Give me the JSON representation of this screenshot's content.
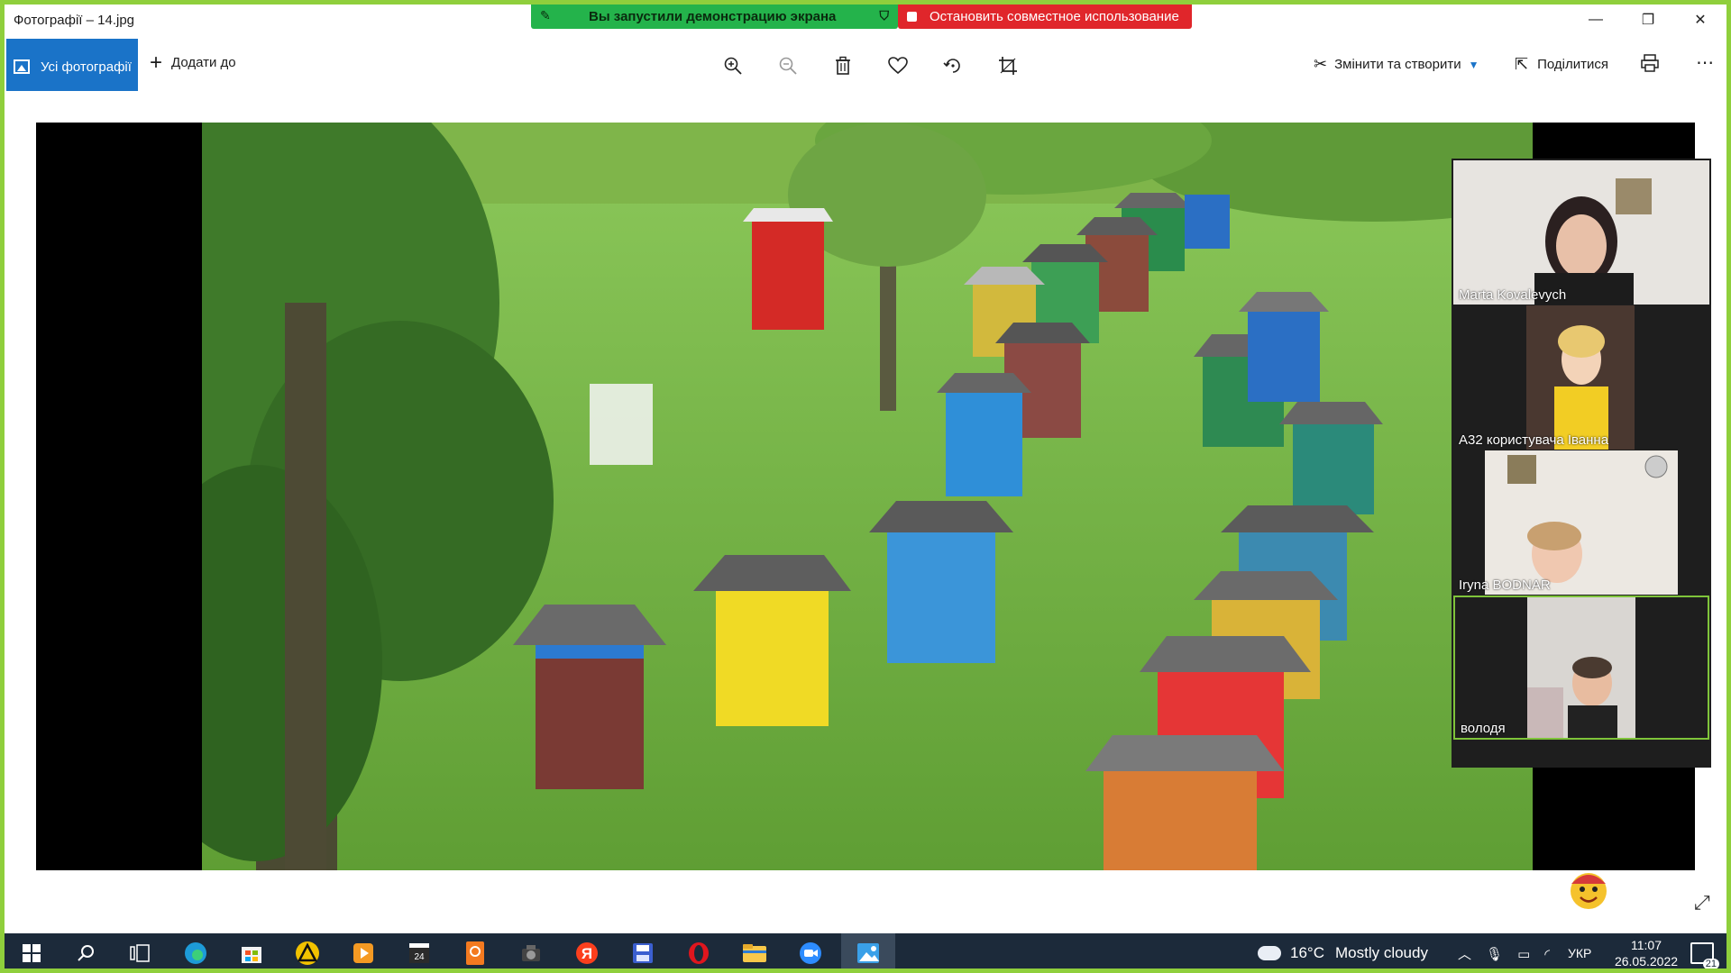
{
  "window": {
    "title": "Фотографії – 14.jpg",
    "minimize_glyph": "—",
    "restore_glyph": "❐",
    "close_glyph": "✕"
  },
  "screen_share": {
    "status_text": "Вы запустили демонстрацию экрана",
    "stop_text": "Остановить совместное использование",
    "green_color": "#24b34b",
    "red_color": "#e0262b"
  },
  "toolbar": {
    "all_photos_label": "Усі фотографії",
    "add_to_label": "Додати до",
    "edit_create_label": "Змінити та створити",
    "share_label": "Поділитися",
    "accent": "#1a73c8",
    "tools": [
      "zoom-in-icon",
      "zoom-out-icon",
      "delete-icon",
      "heart-icon",
      "rotate-icon",
      "crop-icon"
    ]
  },
  "participants": [
    {
      "name": "Marta Kovalevych"
    },
    {
      "name": "А32 користувача Іванна"
    },
    {
      "name": "Iryna BODNAR"
    },
    {
      "name": "володя",
      "active": true
    }
  ],
  "taskbar": {
    "weather_temp": "16°C",
    "weather_desc": "Mostly cloudy",
    "language": "УКР",
    "time": "11:07",
    "date": "26.05.2022",
    "notification_count": "21",
    "apps": [
      "start-icon",
      "search-icon",
      "task-view-icon",
      "edge-icon",
      "store-icon",
      "archicad-icon",
      "media-player-icon",
      "video-editor-icon",
      "pdf-icon",
      "camera-icon",
      "yandex-icon",
      "save-icon",
      "opera-icon",
      "explorer-icon",
      "zoom-icon",
      "photos-icon"
    ]
  }
}
